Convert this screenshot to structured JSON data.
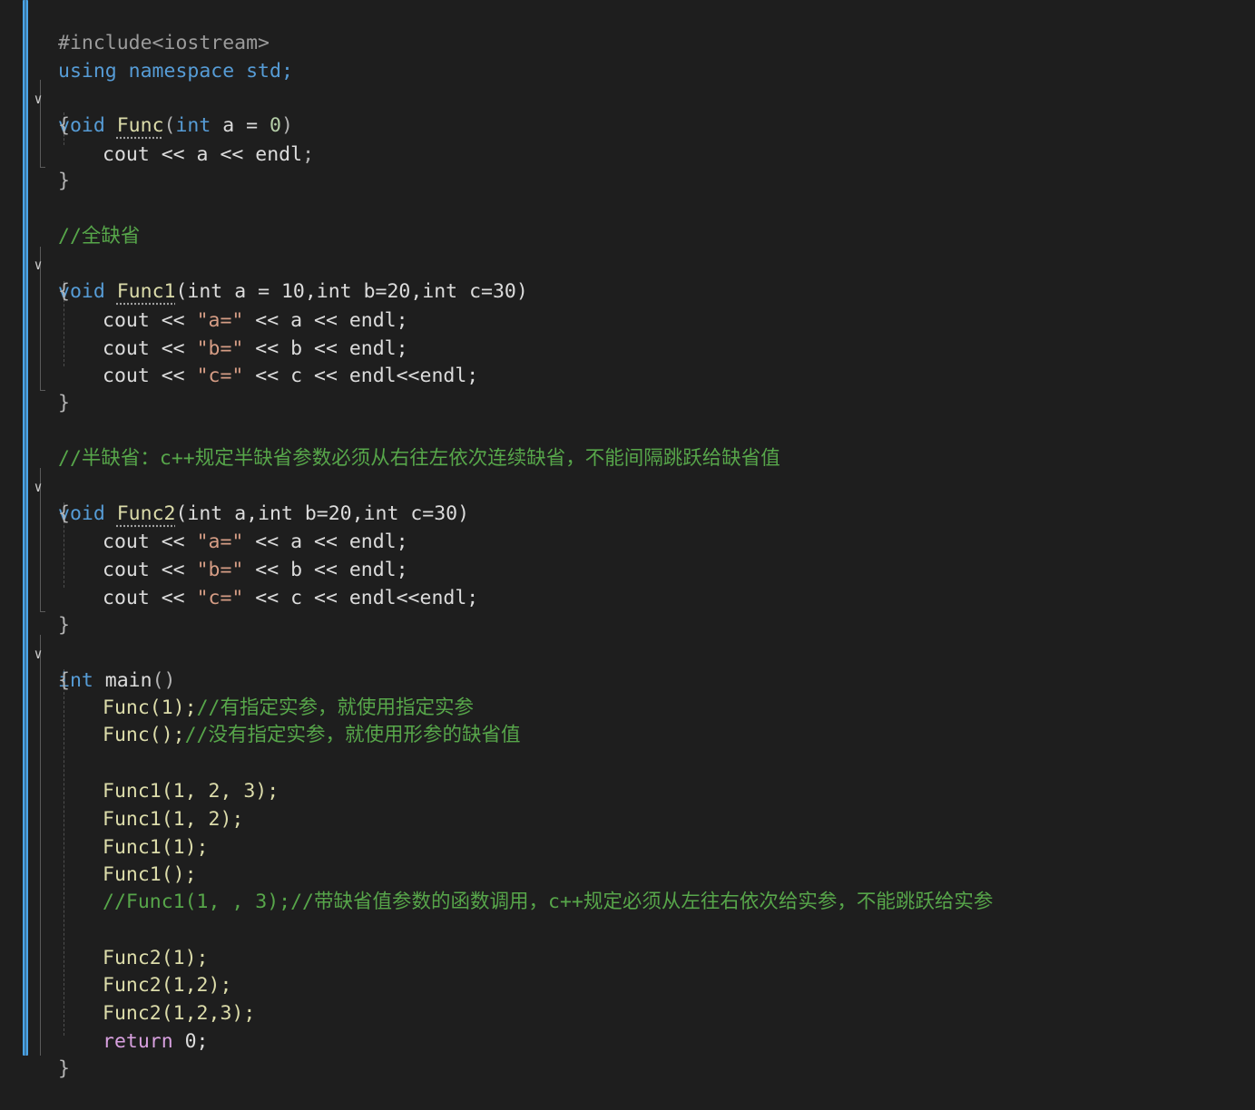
{
  "editor": {
    "lines": {
      "l1": "#include<iostream>",
      "l2": "using namespace std;",
      "l3_kw": "void",
      "l3_fn": "Func",
      "l3_rest1": "(",
      "l3_int": "int",
      "l3_rest2": " a = ",
      "l3_num": "0",
      "l3_rest3": ")",
      "brace_open": "{",
      "brace_close": "}",
      "l5_cout": "cout",
      "l5_rest": " << a << ",
      "l5_endl": "endl",
      "l5_semi": ";",
      "c1": "//全缺省",
      "f1_kw": "void",
      "f1_fn": "Func1",
      "f1_params": "(int a = 10,int b=20,int c=30)",
      "c2": "//半缺省：c++规定半缺省参数必须从右往左依次连续缺省，不能间隔跳跃给缺省值",
      "f2_kw": "void",
      "f2_fn": "Func2",
      "f2_params": "(int a,int b=20,int c=30)",
      "main_kw": "int",
      "main_fn": "main",
      "main_paren": "()",
      "call_func1": "Func(1);",
      "call_func1_cmt": "//有指定实参，就使用指定实参",
      "call_func2": "Func();",
      "call_func2_cmt": "//没有指定实参，就使用形参的缺省值",
      "f1_c1": "Func1(1, 2, 3);",
      "f1_c2": "Func1(1, 2);",
      "f1_c3": "Func1(1);",
      "f1_c4": "Func1();",
      "f1_c5_cmt": "//Func1(1, , 3);//带缺省值参数的函数调用，c++规定必须从左往右依次给实参，不能跳跃给实参",
      "f2_c1": "Func2(1);",
      "f2_c2": "Func2(1,2);",
      "f2_c3": "Func2(1,2,3);",
      "ret": "return",
      "ret_rest": " 0;",
      "cout_a": "\"a=\"",
      "cout_b": "\"b=\"",
      "cout_c": "\"c=\""
    }
  }
}
